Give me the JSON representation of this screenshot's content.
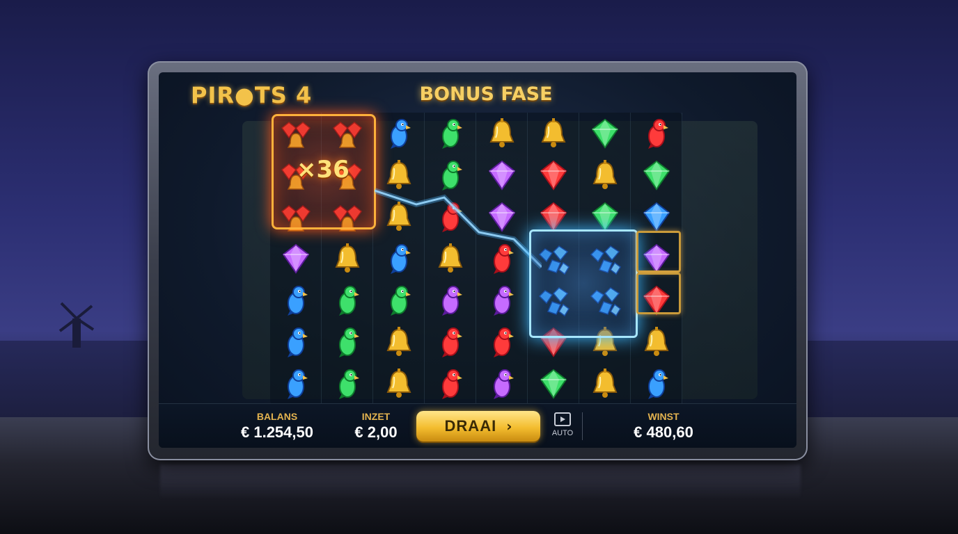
{
  "game": {
    "logo": "PIR●TS 4",
    "phase_title": "BONUS FASE",
    "multiplier": "×36"
  },
  "grid": {
    "columns": 8,
    "rows": 7,
    "cells": [
      [
        "gold-cluster",
        "gold-cluster",
        "blue-parrot",
        "green-parrot",
        "gold-bell",
        "gold-bell",
        "green-gem",
        "red-parrot"
      ],
      [
        "gold-cluster",
        "gold-cluster",
        "gold-bell",
        "green-parrot",
        "purple-gem",
        "red-gem",
        "gold-bell",
        "green-gem"
      ],
      [
        "gold-cluster",
        "gold-cluster",
        "gold-bell",
        "red-parrot",
        "purple-gem",
        "red-gem",
        "green-gem",
        "blue-gem"
      ],
      [
        "purple-gem",
        "gold-bell",
        "blue-parrot",
        "gold-bell",
        "red-parrot",
        "blue-cluster",
        "blue-cluster",
        "purple-gem"
      ],
      [
        "blue-parrot",
        "green-parrot",
        "green-parrot",
        "purple-parrot",
        "purple-parrot",
        "blue-cluster",
        "blue-cluster",
        "red-gem"
      ],
      [
        "blue-parrot",
        "green-parrot",
        "gold-bell",
        "red-parrot",
        "red-parrot",
        "red-gem",
        "gold-bell",
        "gold-bell"
      ],
      [
        "blue-parrot",
        "green-parrot",
        "gold-bell",
        "red-parrot",
        "purple-parrot",
        "green-gem",
        "gold-bell",
        "blue-parrot"
      ]
    ]
  },
  "bottom_bar": {
    "balance_label": "BALANS",
    "balance_value": "€ 1.254,50",
    "bet_label": "INZET",
    "bet_value": "€ 2,00",
    "spin_label": "DRAAI",
    "spin_icon": "chevron-right-icon",
    "auto_label": "AUTO",
    "auto_icon": "play-icon",
    "win_label": "WINST",
    "win_value": "€ 480,60"
  },
  "colors": {
    "gold": "#f3bd2f",
    "accent_text": "#e3b34f",
    "red_cluster_glow": "#ff5a1a",
    "blue_cluster_glow": "#3fb9ff"
  }
}
